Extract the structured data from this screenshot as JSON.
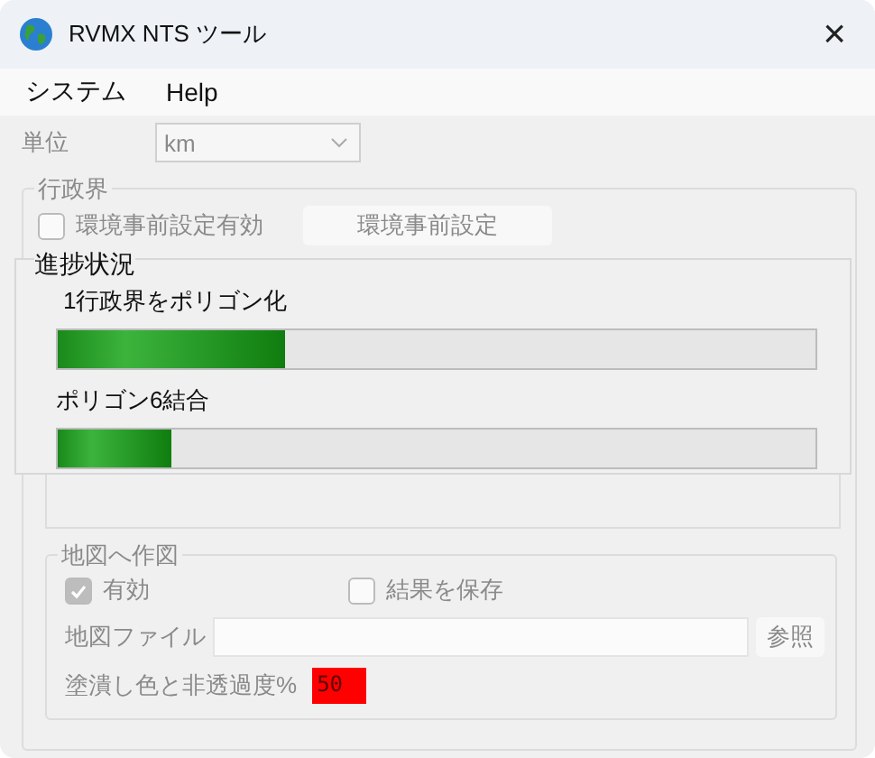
{
  "window": {
    "title": "RVMX NTS ツール",
    "close": "×"
  },
  "menu": [
    {
      "label": "システム"
    },
    {
      "label": "Help"
    }
  ],
  "unit": {
    "label": "単位",
    "value": "km"
  },
  "boundary_group": {
    "title": "行政界",
    "checkbox": {
      "label": "環境事前設定有効",
      "checked": false
    },
    "button": "環境事前設定"
  },
  "progress": {
    "title": "進捗状況",
    "tasks": [
      {
        "label": "1行政界をポリゴン化",
        "level": 0.3
      },
      {
        "label": "ポリゴン6結合",
        "level": 0.15
      }
    ]
  },
  "map_group": {
    "title": "地図へ作図",
    "enabled": {
      "label": "有効",
      "checked": true
    },
    "save": {
      "label": "結果を保存",
      "checked": false
    },
    "file": {
      "label": "地図ファイル",
      "button": "参照"
    },
    "fill": {
      "label": "塗潰し色と非透過度%",
      "value": "50",
      "color": "#ff0000"
    }
  }
}
